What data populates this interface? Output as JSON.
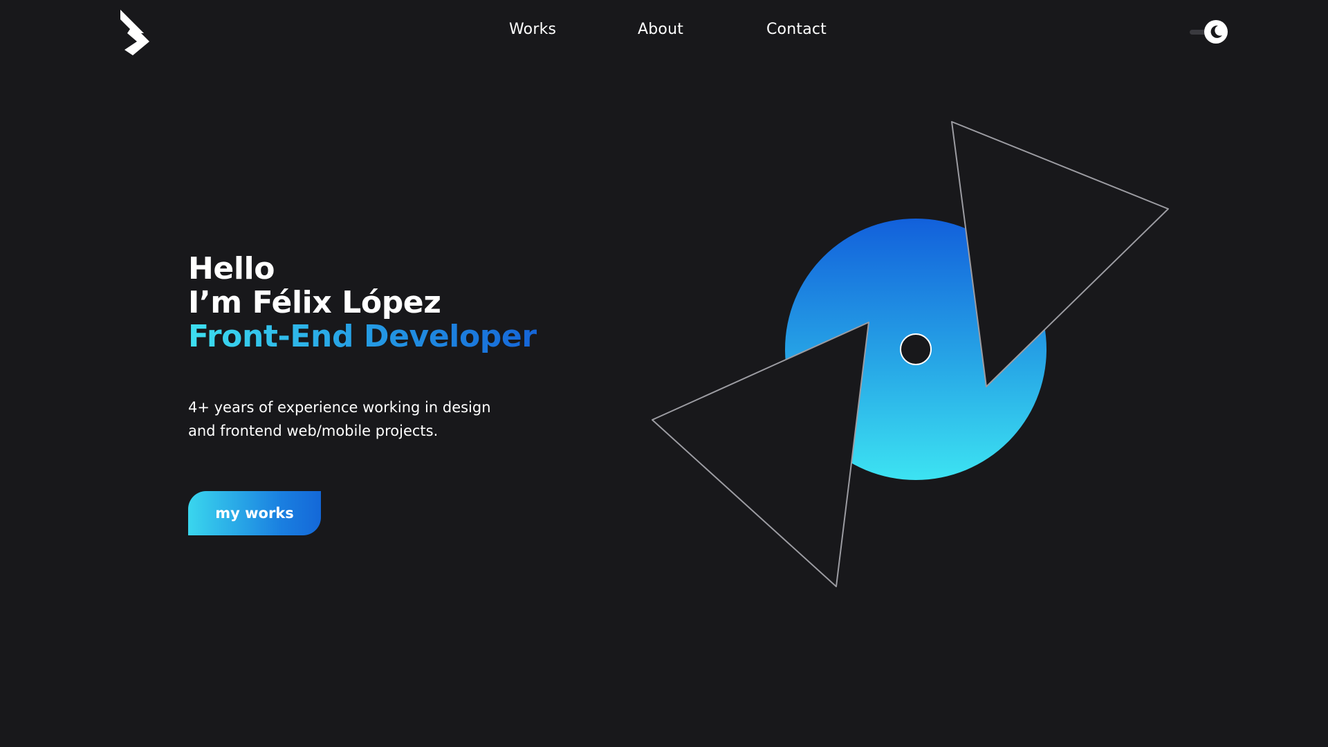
{
  "header": {
    "logo_icon": "double-chevron-logo-icon",
    "nav": {
      "works": "Works",
      "about": "About",
      "contact": "Contact"
    },
    "theme_toggle": {
      "icon": "moon-icon",
      "mode": "dark"
    }
  },
  "hero": {
    "greeting": "Hello",
    "name_line": "I’m Félix López",
    "role": "Front-End Developer",
    "description_line1": "4+ years of experience working in design",
    "description_line2": "and frontend web/mobile projects.",
    "cta_label": "my works"
  },
  "colors": {
    "background": "#18181b",
    "text": "#ffffff",
    "accent_light": "#3ee0f0",
    "accent_dark": "#1565d8"
  }
}
